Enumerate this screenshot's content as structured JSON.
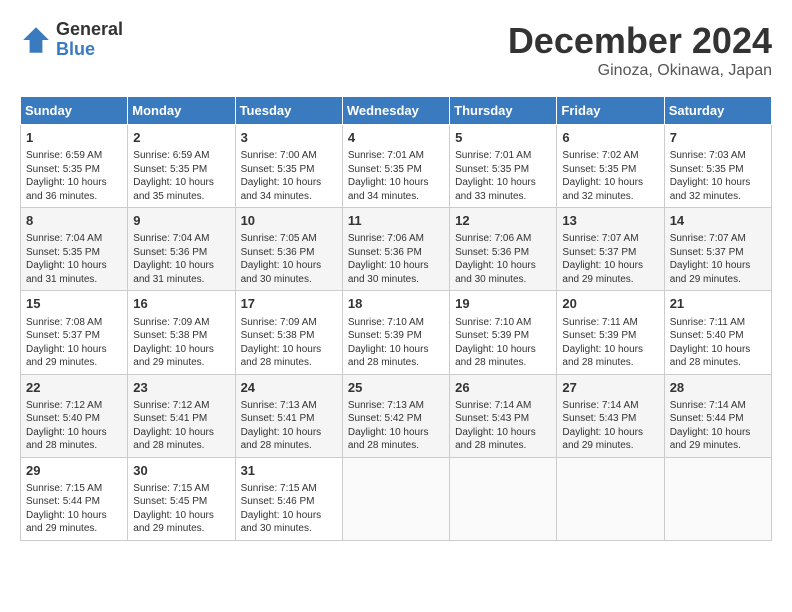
{
  "header": {
    "logo_line1": "General",
    "logo_line2": "Blue",
    "title": "December 2024",
    "subtitle": "Ginoza, Okinawa, Japan"
  },
  "weekdays": [
    "Sunday",
    "Monday",
    "Tuesday",
    "Wednesday",
    "Thursday",
    "Friday",
    "Saturday"
  ],
  "weeks": [
    [
      {
        "day": "1",
        "text": "Sunrise: 6:59 AM\nSunset: 5:35 PM\nDaylight: 10 hours\nand 36 minutes."
      },
      {
        "day": "2",
        "text": "Sunrise: 6:59 AM\nSunset: 5:35 PM\nDaylight: 10 hours\nand 35 minutes."
      },
      {
        "day": "3",
        "text": "Sunrise: 7:00 AM\nSunset: 5:35 PM\nDaylight: 10 hours\nand 34 minutes."
      },
      {
        "day": "4",
        "text": "Sunrise: 7:01 AM\nSunset: 5:35 PM\nDaylight: 10 hours\nand 34 minutes."
      },
      {
        "day": "5",
        "text": "Sunrise: 7:01 AM\nSunset: 5:35 PM\nDaylight: 10 hours\nand 33 minutes."
      },
      {
        "day": "6",
        "text": "Sunrise: 7:02 AM\nSunset: 5:35 PM\nDaylight: 10 hours\nand 32 minutes."
      },
      {
        "day": "7",
        "text": "Sunrise: 7:03 AM\nSunset: 5:35 PM\nDaylight: 10 hours\nand 32 minutes."
      }
    ],
    [
      {
        "day": "8",
        "text": "Sunrise: 7:04 AM\nSunset: 5:35 PM\nDaylight: 10 hours\nand 31 minutes."
      },
      {
        "day": "9",
        "text": "Sunrise: 7:04 AM\nSunset: 5:36 PM\nDaylight: 10 hours\nand 31 minutes."
      },
      {
        "day": "10",
        "text": "Sunrise: 7:05 AM\nSunset: 5:36 PM\nDaylight: 10 hours\nand 30 minutes."
      },
      {
        "day": "11",
        "text": "Sunrise: 7:06 AM\nSunset: 5:36 PM\nDaylight: 10 hours\nand 30 minutes."
      },
      {
        "day": "12",
        "text": "Sunrise: 7:06 AM\nSunset: 5:36 PM\nDaylight: 10 hours\nand 30 minutes."
      },
      {
        "day": "13",
        "text": "Sunrise: 7:07 AM\nSunset: 5:37 PM\nDaylight: 10 hours\nand 29 minutes."
      },
      {
        "day": "14",
        "text": "Sunrise: 7:07 AM\nSunset: 5:37 PM\nDaylight: 10 hours\nand 29 minutes."
      }
    ],
    [
      {
        "day": "15",
        "text": "Sunrise: 7:08 AM\nSunset: 5:37 PM\nDaylight: 10 hours\nand 29 minutes."
      },
      {
        "day": "16",
        "text": "Sunrise: 7:09 AM\nSunset: 5:38 PM\nDaylight: 10 hours\nand 29 minutes."
      },
      {
        "day": "17",
        "text": "Sunrise: 7:09 AM\nSunset: 5:38 PM\nDaylight: 10 hours\nand 28 minutes."
      },
      {
        "day": "18",
        "text": "Sunrise: 7:10 AM\nSunset: 5:39 PM\nDaylight: 10 hours\nand 28 minutes."
      },
      {
        "day": "19",
        "text": "Sunrise: 7:10 AM\nSunset: 5:39 PM\nDaylight: 10 hours\nand 28 minutes."
      },
      {
        "day": "20",
        "text": "Sunrise: 7:11 AM\nSunset: 5:39 PM\nDaylight: 10 hours\nand 28 minutes."
      },
      {
        "day": "21",
        "text": "Sunrise: 7:11 AM\nSunset: 5:40 PM\nDaylight: 10 hours\nand 28 minutes."
      }
    ],
    [
      {
        "day": "22",
        "text": "Sunrise: 7:12 AM\nSunset: 5:40 PM\nDaylight: 10 hours\nand 28 minutes."
      },
      {
        "day": "23",
        "text": "Sunrise: 7:12 AM\nSunset: 5:41 PM\nDaylight: 10 hours\nand 28 minutes."
      },
      {
        "day": "24",
        "text": "Sunrise: 7:13 AM\nSunset: 5:41 PM\nDaylight: 10 hours\nand 28 minutes."
      },
      {
        "day": "25",
        "text": "Sunrise: 7:13 AM\nSunset: 5:42 PM\nDaylight: 10 hours\nand 28 minutes."
      },
      {
        "day": "26",
        "text": "Sunrise: 7:14 AM\nSunset: 5:43 PM\nDaylight: 10 hours\nand 28 minutes."
      },
      {
        "day": "27",
        "text": "Sunrise: 7:14 AM\nSunset: 5:43 PM\nDaylight: 10 hours\nand 29 minutes."
      },
      {
        "day": "28",
        "text": "Sunrise: 7:14 AM\nSunset: 5:44 PM\nDaylight: 10 hours\nand 29 minutes."
      }
    ],
    [
      {
        "day": "29",
        "text": "Sunrise: 7:15 AM\nSunset: 5:44 PM\nDaylight: 10 hours\nand 29 minutes."
      },
      {
        "day": "30",
        "text": "Sunrise: 7:15 AM\nSunset: 5:45 PM\nDaylight: 10 hours\nand 29 minutes."
      },
      {
        "day": "31",
        "text": "Sunrise: 7:15 AM\nSunset: 5:46 PM\nDaylight: 10 hours\nand 30 minutes."
      },
      {
        "day": "",
        "text": ""
      },
      {
        "day": "",
        "text": ""
      },
      {
        "day": "",
        "text": ""
      },
      {
        "day": "",
        "text": ""
      }
    ]
  ]
}
